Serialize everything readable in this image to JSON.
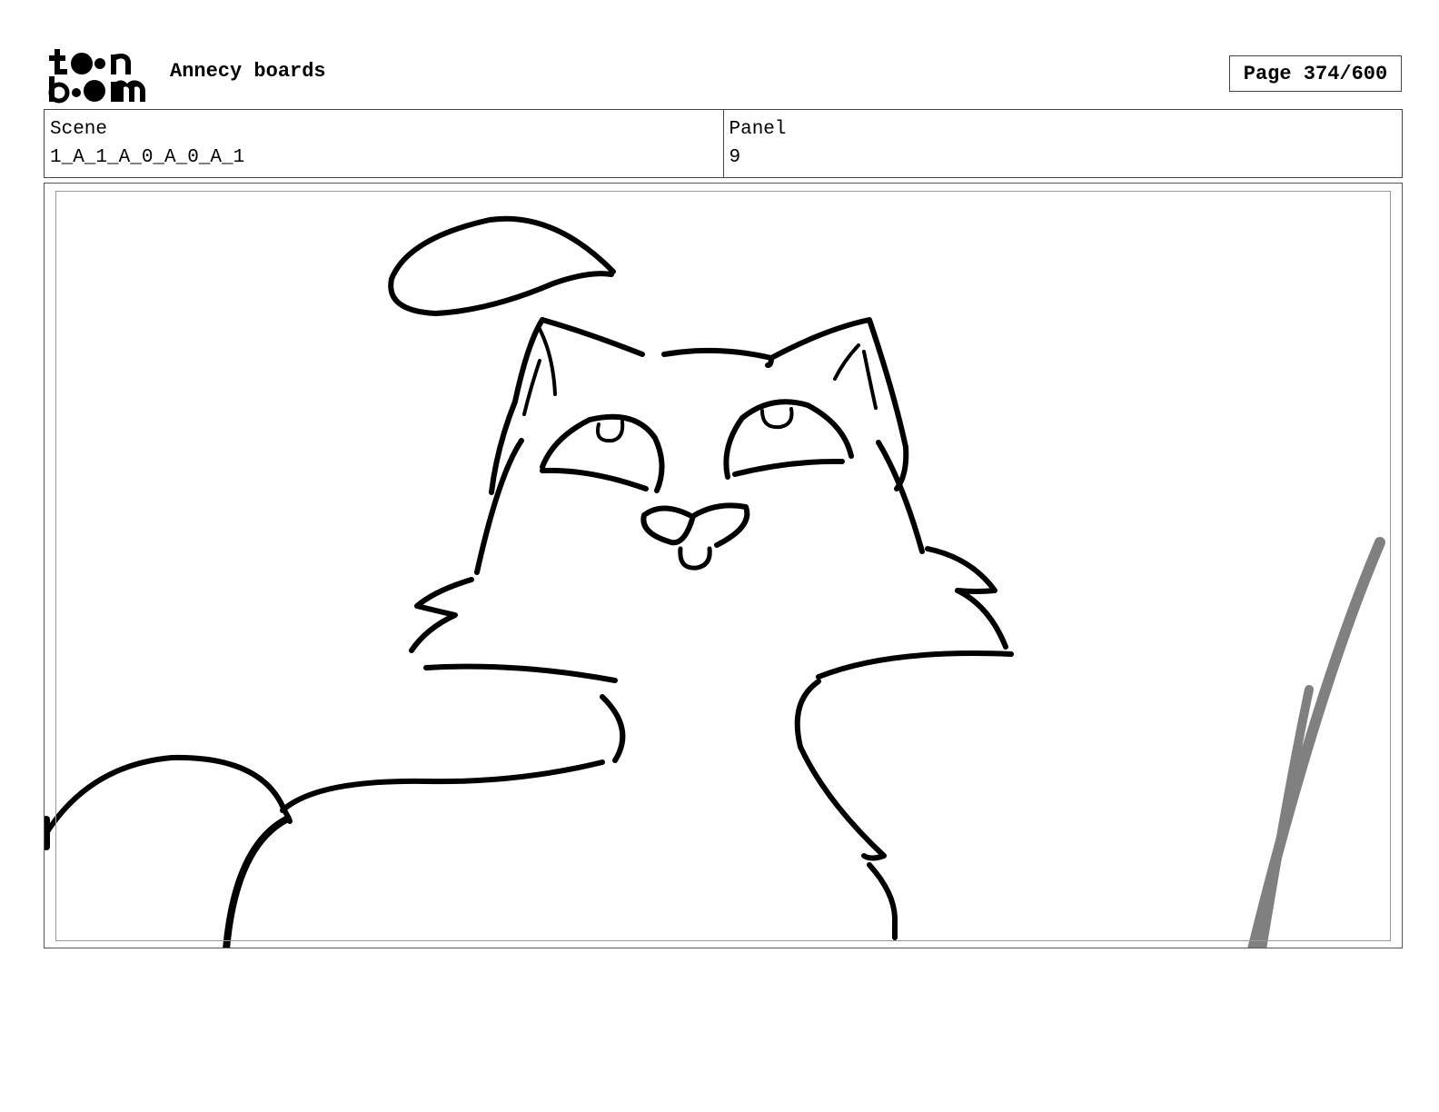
{
  "header": {
    "app_title": "Annecy boards",
    "page_label": "Page 374/600",
    "logo_text_top": "toon",
    "logo_text_bottom": "boom"
  },
  "info": {
    "scene_label": "Scene",
    "scene_value": "1_A_1_A_0_A_0_A_1",
    "panel_label": "Panel",
    "panel_value": "9"
  },
  "panel": {
    "drawing_subject": "cat-sketch",
    "stroke_color": "#000000",
    "accent_stroke_color": "#808080"
  }
}
